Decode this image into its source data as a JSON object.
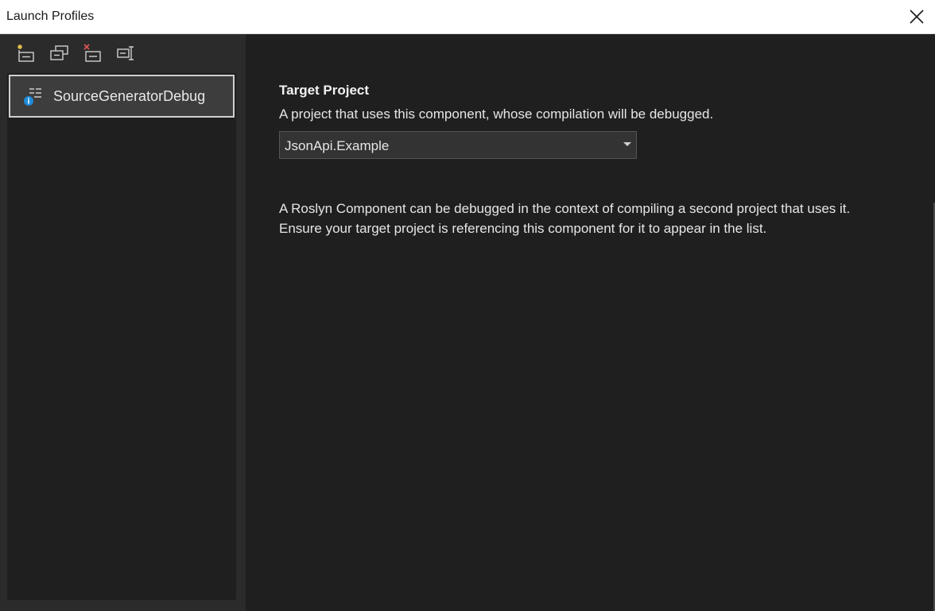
{
  "window": {
    "title": "Launch Profiles",
    "close_icon": "close-icon"
  },
  "toolbar": {
    "buttons": [
      {
        "name": "new-profile",
        "icon": "new-profile-icon"
      },
      {
        "name": "duplicate-profile",
        "icon": "duplicate-profile-icon"
      },
      {
        "name": "delete-profile",
        "icon": "delete-profile-icon"
      },
      {
        "name": "rename-profile",
        "icon": "rename-profile-icon"
      }
    ]
  },
  "profiles": [
    {
      "label": "SourceGeneratorDebug",
      "icon": "roslyn-component-profile-icon",
      "selected": true
    }
  ],
  "settings": {
    "target_project": {
      "title": "Target Project",
      "description": "A project that uses this component, whose compilation will be debugged.",
      "selected_value": "JsonApi.Example"
    },
    "info": "A Roslyn Component can be debugged in the context of compiling a second project that uses it. Ensure your target project is referencing this component for it to appear in the list."
  },
  "colors": {
    "background": "#1f1f1f",
    "left_pane": "#2b2b2b",
    "selected_item": "#3d3d3d",
    "info_badge": "#1e8ad7",
    "delete_accent": "#e05555"
  }
}
